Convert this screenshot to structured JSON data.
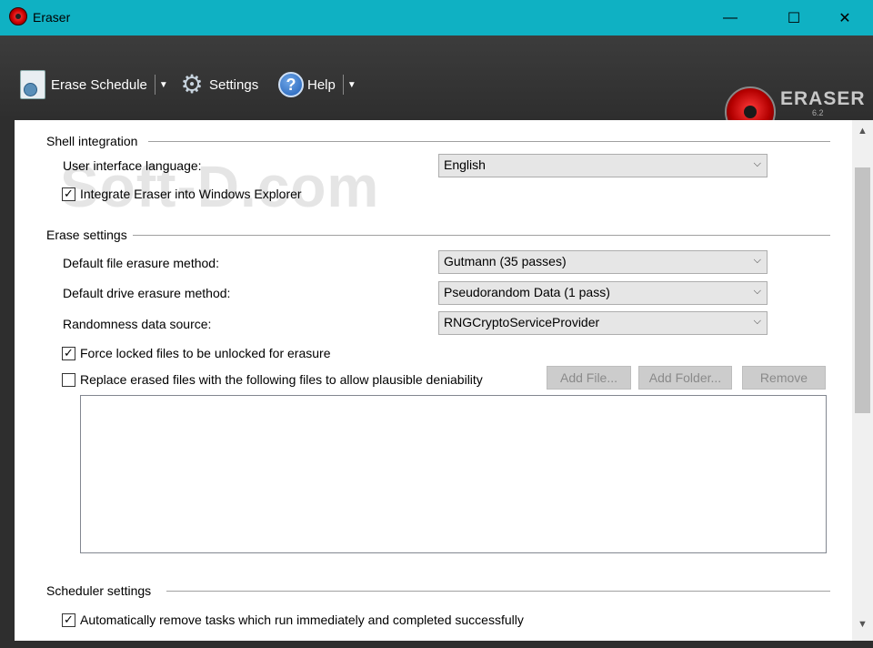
{
  "window": {
    "title": "Eraser",
    "minimize": "—",
    "maximize": "☐",
    "close": "✕"
  },
  "toolbar": {
    "erase_schedule": "Erase Schedule",
    "settings": "Settings",
    "help": "Help",
    "help_icon": "?",
    "dropdown_arrow": "▼"
  },
  "logo": {
    "name": "ERASER",
    "version": "6.2"
  },
  "watermark": "Soft-D.com",
  "shell": {
    "title": "Shell integration",
    "language_label": "User interface language:",
    "language_value": "English",
    "integrate_label": "Integrate Eraser into Windows Explorer",
    "integrate_checked": true
  },
  "erase": {
    "title": "Erase settings",
    "file_method_label": "Default file erasure method:",
    "file_method_value": "Gutmann (35 passes)",
    "drive_method_label": "Default drive erasure method:",
    "drive_method_value": "Pseudorandom Data (1 pass)",
    "random_label": "Randomness data source:",
    "random_value": "RNGCryptoServiceProvider",
    "force_label": "Force locked files to be unlocked for erasure",
    "force_checked": true,
    "replace_label": "Replace erased files with the following files to allow plausible deniability",
    "replace_checked": false,
    "add_file": "Add File...",
    "add_folder": "Add Folder...",
    "remove": "Remove"
  },
  "scheduler": {
    "title": "Scheduler settings",
    "auto_remove_label": "Automatically remove tasks which run immediately and completed successfully",
    "auto_remove_checked": true
  },
  "glyphs": {
    "chevron": "⌵",
    "check": "✓",
    "scroll_up": "▲",
    "scroll_down": "▼"
  }
}
